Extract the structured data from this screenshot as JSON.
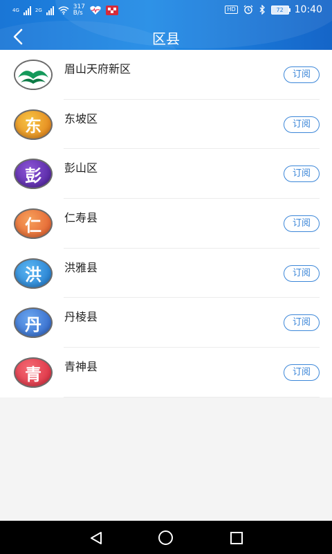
{
  "status_bar": {
    "network_1": "4G",
    "network_2": "2G",
    "speed_value": "317",
    "speed_unit": "B/s",
    "hd_badge": "HD",
    "battery_level": "72",
    "time": "10:40"
  },
  "header": {
    "title": "区县"
  },
  "districts": [
    {
      "name": "眉山天府新区",
      "glyph": "",
      "colors": [
        "#3aa56a",
        "#0a7a44"
      ],
      "subscribe": "订阅"
    },
    {
      "name": "东坡区",
      "glyph": "东",
      "colors": [
        "#f6c443",
        "#e07a16"
      ],
      "subscribe": "订阅"
    },
    {
      "name": "彭山区",
      "glyph": "彭",
      "colors": [
        "#8c55d6",
        "#4a1e98"
      ],
      "subscribe": "订阅"
    },
    {
      "name": "仁寿县",
      "glyph": "仁",
      "colors": [
        "#f6a05a",
        "#e0582a"
      ],
      "subscribe": "订阅"
    },
    {
      "name": "洪雅县",
      "glyph": "洪",
      "colors": [
        "#5bb6f2",
        "#1b74c9"
      ],
      "subscribe": "订阅"
    },
    {
      "name": "丹棱县",
      "glyph": "丹",
      "colors": [
        "#6aa6ef",
        "#2a5fc4"
      ],
      "subscribe": "订阅"
    },
    {
      "name": "青神县",
      "glyph": "青",
      "colors": [
        "#f46a74",
        "#d8283b"
      ],
      "subscribe": "订阅"
    }
  ]
}
